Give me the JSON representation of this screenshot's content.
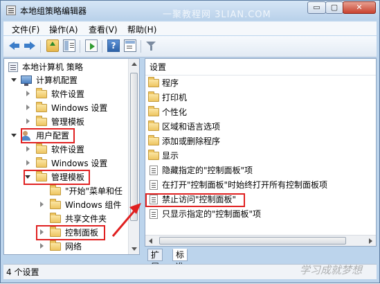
{
  "window": {
    "title": "本地组策略编辑器",
    "min_label": "▭",
    "max_label": "▢",
    "close_label": "✕"
  },
  "menu": [
    "文件(F)",
    "操作(A)",
    "查看(V)",
    "帮助(H)"
  ],
  "tree": {
    "root": "本地计算机 策略",
    "computer_config": "计算机配置",
    "cc_software": "软件设置",
    "cc_windows": "Windows 设置",
    "cc_admin": "管理模板",
    "user_config": "用户配置",
    "uc_software": "软件设置",
    "uc_windows": "Windows 设置",
    "uc_admin": "管理模板",
    "start_menu": "\"开始\"菜单和任",
    "windows_components": "Windows 组件",
    "shared_folders": "共享文件夹",
    "control_panel": "控制面板",
    "network": "网络"
  },
  "list": {
    "header": "设置",
    "items": [
      {
        "label": "程序",
        "icon": "folder-icon"
      },
      {
        "label": "打印机",
        "icon": "folder-icon"
      },
      {
        "label": "个性化",
        "icon": "folder-icon"
      },
      {
        "label": "区域和语言选项",
        "icon": "folder-icon"
      },
      {
        "label": "添加或删除程序",
        "icon": "folder-icon"
      },
      {
        "label": "显示",
        "icon": "folder-icon"
      },
      {
        "label": "隐藏指定的\"控制面板\"项",
        "icon": "policy-setting-icon"
      },
      {
        "label": "在打开\"控制面板\"时始终打开所有控制面板项",
        "icon": "policy-setting-icon"
      },
      {
        "label": "禁止访问\"控制面板\"",
        "icon": "policy-setting-icon"
      },
      {
        "label": "只显示指定的\"控制面板\"项",
        "icon": "policy-setting-icon"
      }
    ]
  },
  "tabs": [
    "扩展",
    "标准"
  ],
  "status": "4 个设置",
  "watermarks": {
    "top": "一聚教程网 3LIAN.COM",
    "bottom": "学习成就梦想"
  },
  "colors": {
    "highlight": "#e02020",
    "accent": "#3b7dc9"
  }
}
